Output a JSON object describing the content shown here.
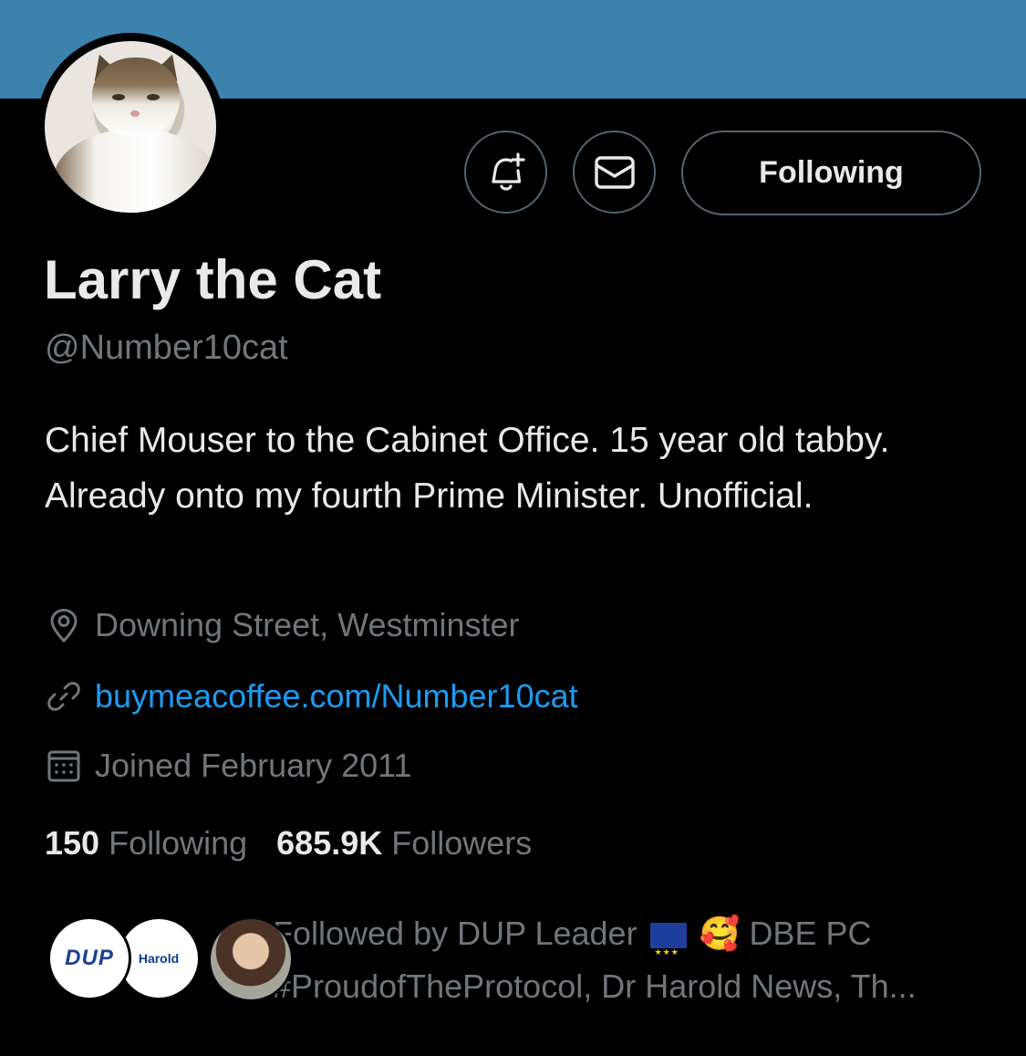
{
  "profile": {
    "name": "Larry the Cat",
    "handle": "@Number10cat",
    "bio": "Chief Mouser to the Cabinet Office. 15 year old tabby. Already onto my fourth Prime Minister. Unofficial.",
    "location": "Downing Street, Westminster",
    "website": "buymeacoffee.com/Number10cat",
    "joined": "Joined February 2011"
  },
  "actions": {
    "following_label": "Following",
    "notify_icon": "bell-plus-icon",
    "message_icon": "envelope-icon"
  },
  "stats": {
    "following_count": "150",
    "following_label": "Following",
    "followers_count": "685.9K",
    "followers_label": "Followers"
  },
  "followed_by": {
    "prefix": "Followed by DUP Leader",
    "emoji": "🥰",
    "part2": "DBE PC #ProudofTheProtocol, Dr Harold News, Th...",
    "avatar1_text": "DUP",
    "avatar2_text": "Harold"
  },
  "colors": {
    "banner": "#3b82ad",
    "link": "#1d9bf0",
    "muted": "#71767b"
  }
}
